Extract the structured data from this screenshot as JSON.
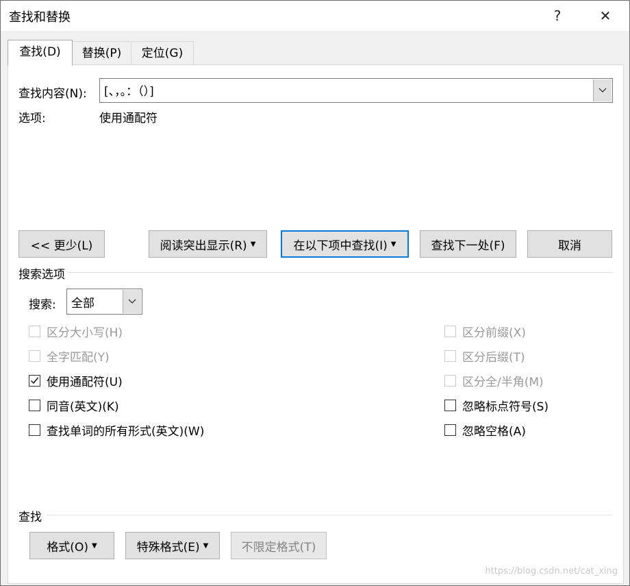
{
  "window": {
    "title": "查找和替换",
    "help": "?",
    "close": "✕"
  },
  "tabs": [
    {
      "label": "查找(D)",
      "active": true
    },
    {
      "label": "替换(P)",
      "active": false
    },
    {
      "label": "定位(G)",
      "active": false
    }
  ],
  "find": {
    "label": "查找内容(N):",
    "value": "[、，。：（）]",
    "options_label": "选项:",
    "options_value": "使用通配符"
  },
  "buttons": {
    "less": "<< 更少(L)",
    "highlight": "阅读突出显示(R)",
    "find_in": "在以下项中查找(I)",
    "find_next": "查找下一处(F)",
    "cancel": "取消"
  },
  "search_options": {
    "title": "搜索选项",
    "search_label": "搜索:",
    "search_value": "全部",
    "left": [
      {
        "label": "区分大小写(H)",
        "checked": false,
        "enabled": false
      },
      {
        "label": "全字匹配(Y)",
        "checked": false,
        "enabled": false
      },
      {
        "label": "使用通配符(U)",
        "checked": true,
        "enabled": true
      },
      {
        "label": "同音(英文)(K)",
        "checked": false,
        "enabled": true
      },
      {
        "label": "查找单词的所有形式(英文)(W)",
        "checked": false,
        "enabled": true
      }
    ],
    "right": [
      {
        "label": "区分前缀(X)",
        "checked": false,
        "enabled": false
      },
      {
        "label": "区分后缀(T)",
        "checked": false,
        "enabled": false
      },
      {
        "label": "区分全/半角(M)",
        "checked": false,
        "enabled": false
      },
      {
        "label": "忽略标点符号(S)",
        "checked": false,
        "enabled": true
      },
      {
        "label": "忽略空格(A)",
        "checked": false,
        "enabled": true
      }
    ]
  },
  "find_section": {
    "title": "查找",
    "format": "格式(O)",
    "special": "特殊格式(E)",
    "no_format": "不限定格式(T)"
  },
  "watermark": "https://blog.csdn.net/cat_xing"
}
